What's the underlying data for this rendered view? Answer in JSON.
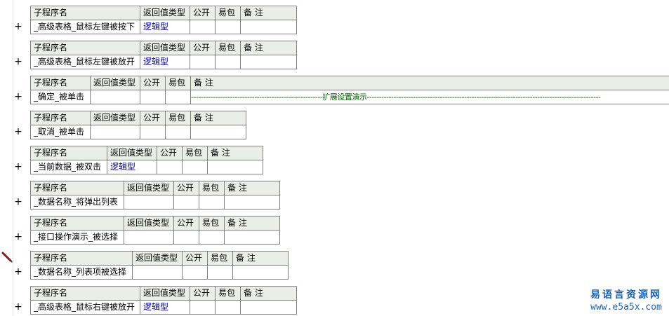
{
  "headers": {
    "name": "子程序名",
    "return_type": "返回值类型",
    "public": "公开",
    "easy_package": "易包",
    "remark": "备 注"
  },
  "subroutines": [
    {
      "expander": "+",
      "name": "_高级表格_鼠标左键被按下",
      "return_type": "逻辑型",
      "public": "",
      "easy_package": "",
      "remark": ""
    },
    {
      "expander": "+",
      "name": "_高级表格_鼠标左键被放开",
      "return_type": "逻辑型",
      "public": "",
      "easy_package": "",
      "remark": ""
    },
    {
      "expander": "+",
      "name": "_确定_被单击",
      "return_type": "",
      "public": "",
      "easy_package": "",
      "remark": "------------------------------------------------------扩展设置演示------------------------------------------------------------------------------------------------"
    },
    {
      "expander": "+",
      "name": "_取消_被单击",
      "return_type": "",
      "public": "",
      "easy_package": "",
      "remark": ""
    },
    {
      "expander": "+",
      "name": "_当前数据_被双击",
      "return_type": "逻辑型",
      "public": "",
      "easy_package": "",
      "remark": ""
    },
    {
      "expander": "+",
      "name": "_数据名称_将弹出列表",
      "return_type": "",
      "public": "",
      "easy_package": "",
      "remark": ""
    },
    {
      "expander": "+",
      "name": "_接口操作演示_被选择",
      "return_type": "",
      "public": "",
      "easy_package": "",
      "remark": ""
    },
    {
      "expander": "+",
      "name": "_数据名称_列表项被选择",
      "return_type": "",
      "public": "",
      "easy_package": "",
      "remark": ""
    },
    {
      "expander": "+",
      "name": "_高级表格_鼠标右键被放开",
      "return_type": "逻辑型",
      "public": "",
      "easy_package": "",
      "remark": ""
    }
  ],
  "watermark": {
    "title": "易语言资源网",
    "url": "www.e5a5x.com"
  },
  "icons": {
    "expander": "plus-icon",
    "marker": "pencil-icon"
  },
  "colors": {
    "header_bg": "#e9efe6",
    "return_type_text": "#000080",
    "remark_text": "#006400",
    "watermark": "#1a66b3"
  }
}
